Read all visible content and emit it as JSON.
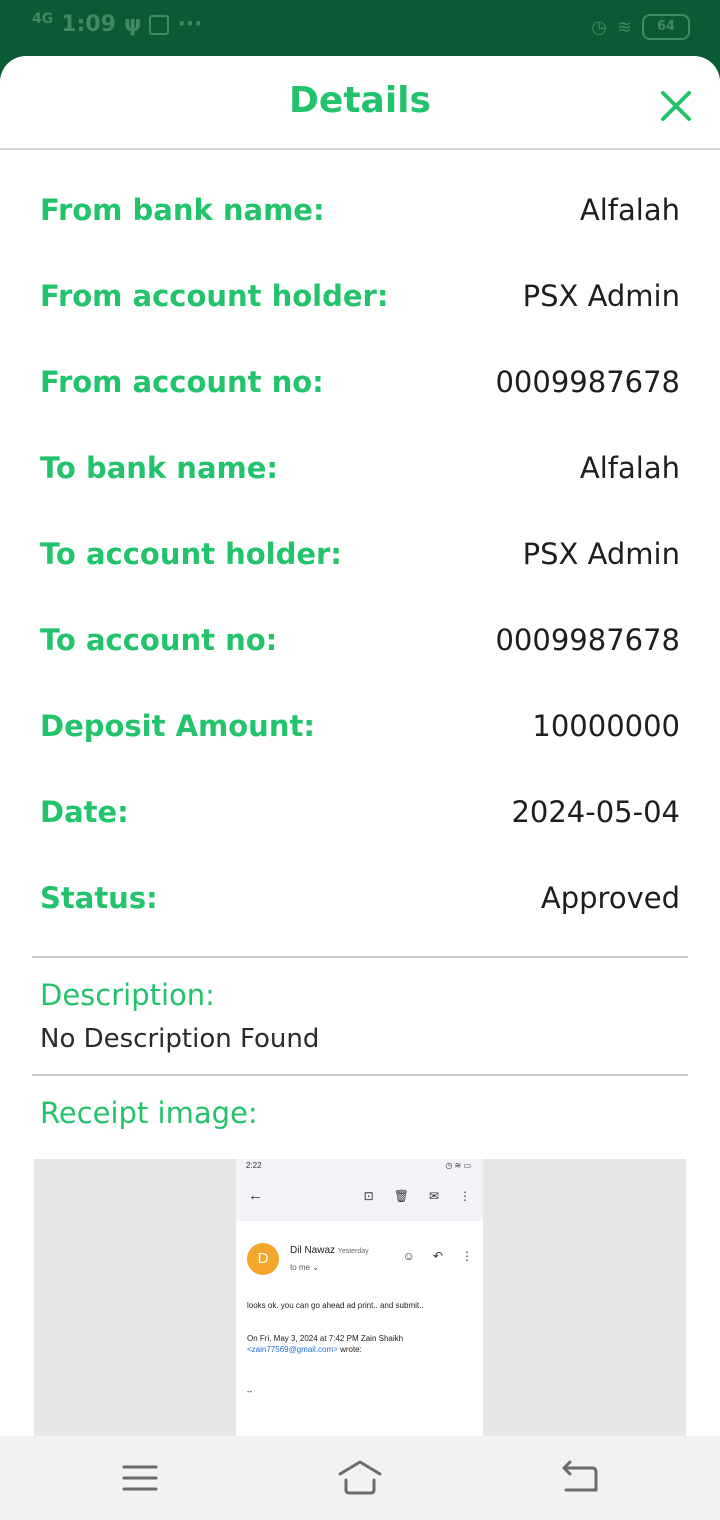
{
  "status_bar": {
    "network": "4G",
    "time": "1:09",
    "battery": "64",
    "icons": [
      "signal-icon",
      "usb-icon",
      "notification-icon",
      "alarm-icon",
      "wifi-icon",
      "battery-icon"
    ]
  },
  "sheet": {
    "title": "Details",
    "close_icon": "close-icon"
  },
  "details": [
    {
      "label": "From bank name:",
      "value": "Alfalah"
    },
    {
      "label": "From account holder:",
      "value": "PSX Admin"
    },
    {
      "label": "From account no:",
      "value": "0009987678"
    },
    {
      "label": "To bank name:",
      "value": "Alfalah"
    },
    {
      "label": "To account holder:",
      "value": "PSX Admin"
    },
    {
      "label": "To account no:",
      "value": "0009987678"
    },
    {
      "label": "Deposit Amount:",
      "value": "10000000"
    },
    {
      "label": "Date:",
      "value": "2024-05-04"
    },
    {
      "label": "Status:",
      "value": "Approved"
    }
  ],
  "description": {
    "label": "Description:",
    "value": "No Description Found"
  },
  "receipt": {
    "label": "Receipt image:",
    "shot": {
      "status_time": "2:22",
      "avatar_letter": "D",
      "sender": "Dil Nawaz",
      "sent_when": "Yesterday",
      "to": "to me",
      "body": "looks ok. you can go ahead ad print.. and submit..",
      "quote_line1": "On Fri, May 3, 2024 at 7:42 PM Zain Shaikh",
      "quote_email": "<zain77569@gmail.com>",
      "quote_wrote": " wrote:",
      "dash": "--"
    }
  },
  "colors": {
    "accent": "#23c36b",
    "status_bar": "#0a5a34",
    "value_text": "#1e1e1e"
  },
  "navbar": {
    "icons": [
      "menu-icon",
      "home-icon",
      "back-icon"
    ]
  }
}
